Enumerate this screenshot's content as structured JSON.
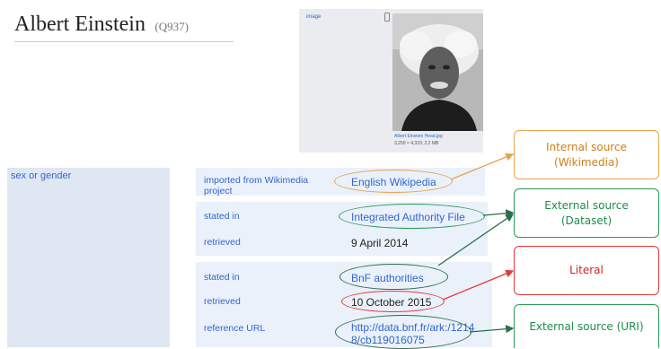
{
  "item": {
    "name": "Albert Einstein",
    "qid": "(Q937)"
  },
  "image": {
    "label": "image",
    "filename": "Albert Einstein Head.jpg",
    "meta": "3,250 × 4,333; 2.2 MB"
  },
  "property": {
    "label": "sex or gender"
  },
  "references": [
    {
      "key": "imported from Wikimedia project",
      "value": "English Wikipedia"
    },
    {
      "key": "stated in",
      "value": "Integrated Authority File"
    },
    {
      "key": "retrieved",
      "value": "9 April 2014"
    },
    {
      "key": "stated in",
      "value": "BnF authorities"
    },
    {
      "key": "retrieved",
      "value": "10 October 2015"
    },
    {
      "key": "reference URL",
      "value_line1": "http://data.bnf.fr/ark:/1214",
      "value_line2": "8/cb119016075"
    }
  ],
  "callouts": {
    "internal": {
      "line1": "Internal source",
      "line2": "(Wikimedia)"
    },
    "dataset": {
      "line1": "External source",
      "line2": "(Dataset)"
    },
    "literal": {
      "line1": "Literal"
    },
    "uri": {
      "line1": "External source (URI)"
    }
  },
  "colors": {
    "link": "#3366cc",
    "internal": "#e6a24d",
    "external": "#2a9a57",
    "literal": "#e53935"
  }
}
